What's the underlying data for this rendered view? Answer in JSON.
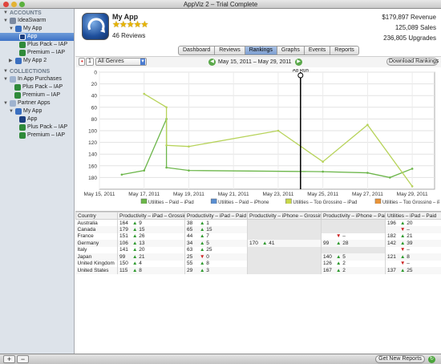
{
  "window": {
    "title": "AppViz 2 – Trial Complete"
  },
  "sidebar": {
    "accounts_header": "ACCOUNTS",
    "account": "IdeaSwarm",
    "my_app": "My App",
    "app": "App",
    "plus_pack": "Plus Pack – IAP",
    "premium": "Premium – IAP",
    "my_app_2": "My App 2",
    "collections_header": "COLLECTIONS",
    "in_app_purchases": "In App Purchases",
    "coll_plus": "Plus Pack – IAP",
    "coll_premium": "Premium – IAP",
    "partner_apps": "Partner Apps",
    "partner_my_app": "My App",
    "partner_app": "App",
    "partner_plus": "Plus Pack – IAP",
    "partner_premium": "Premium – IAP"
  },
  "header": {
    "app_name": "My App",
    "stars": "★★★★★",
    "reviews": "46 Reviews",
    "revenue_value": "$179,897",
    "revenue_label": "Revenue",
    "sales_value": "125,089",
    "sales_label": "Sales",
    "upgrades_value": "236,805",
    "upgrades_label": "Upgrades"
  },
  "tabs": [
    "Dashboard",
    "Reviews",
    "Rankings",
    "Graphs",
    "Events",
    "Reports"
  ],
  "toolbar": {
    "pin_value": "1",
    "genre": "All Genres",
    "date_range": "May 15, 2011 – May 29, 2011",
    "download_button": "Download Rankings"
  },
  "bottom": {
    "get_reports": "Get New Reports",
    "add": "+",
    "remove": "−"
  },
  "chart_data": {
    "type": "line",
    "annotation": "Ad Run",
    "annotation_x": "May 24, 2011",
    "x_ticks": [
      "May 15, 2011",
      "May 17, 2011",
      "May 19, 2011",
      "May 21, 2011",
      "May 23, 2011",
      "May 25, 2011",
      "May 27, 2011",
      "May 29, 2011"
    ],
    "xlim": [
      "May 15, 2011",
      "May 30, 2011"
    ],
    "y_ticks": [
      "0",
      "20",
      "40",
      "60",
      "80",
      "100",
      "120",
      "140",
      "160",
      "180"
    ],
    "ylim": [
      0,
      200
    ],
    "y_inverted": true,
    "grid": true,
    "legend_position": "bottom",
    "series": [
      {
        "name": "Utilities – Paid – iPad",
        "color": "#6cb64a",
        "x": [
          "May 16, 2011",
          "May 17, 2011",
          "May 18, 2011",
          "May 18, 2011",
          "May 18, 2011",
          "May 19, 2011",
          "May 25, 2011",
          "May 27, 2011",
          "May 28, 2011",
          "May 29, 2011"
        ],
        "y": [
          175,
          168,
          80,
          80,
          163,
          168,
          170,
          172,
          180,
          165
        ]
      },
      {
        "name": "Utilities – Top Grossing – iPad",
        "color": "#b7d35a",
        "x": [
          "May 17, 2011",
          "May 18, 2011",
          "May 18, 2011",
          "May 19, 2011",
          "May 23, 2011",
          "May 25, 2011",
          "May 27, 2011",
          "May 29, 2011"
        ],
        "y": [
          37,
          60,
          125,
          127,
          100,
          153,
          90,
          195
        ]
      }
    ],
    "legend_series": [
      {
        "name": "Utilities – Paid – iPad",
        "color": "#6cb64a"
      },
      {
        "name": "Utilities – Paid – iPhone",
        "color": "#5a8ed0"
      },
      {
        "name": "Utilities – Top Grossing – iPad",
        "color": "#c8d84a"
      },
      {
        "name": "Utilities – Top Grossing – iPhone",
        "color": "#e8943a"
      }
    ]
  },
  "table": {
    "headers": [
      "Country",
      "Productivity – iPad – Grossing",
      "Productivity – iPad – Paid",
      "Productivity – iPhone – Grossing",
      "Productivity – iPhone – Paid",
      "Utilities – iPad – Paid"
    ],
    "rows": [
      {
        "country": "Australia",
        "cells": [
          [
            "164",
            "up",
            "9"
          ],
          [
            "38",
            "up",
            "1"
          ],
          null,
          null,
          [
            "196",
            "up",
            "20"
          ]
        ]
      },
      {
        "country": "Canada",
        "cells": [
          [
            "179",
            "up",
            "15"
          ],
          [
            "65",
            "up",
            "15"
          ],
          null,
          null,
          [
            "",
            "dn",
            "–"
          ]
        ]
      },
      {
        "country": "France",
        "cells": [
          [
            "151",
            "up",
            "26"
          ],
          [
            "44",
            "up",
            "7"
          ],
          null,
          [
            "",
            "dn",
            "–"
          ],
          [
            "182",
            "up",
            "21"
          ]
        ]
      },
      {
        "country": "Germany",
        "cells": [
          [
            "106",
            "up",
            "13"
          ],
          [
            "34",
            "up",
            "5"
          ],
          [
            "170",
            "up",
            "41"
          ],
          [
            "99",
            "up",
            "28"
          ],
          [
            "142",
            "up",
            "39"
          ]
        ]
      },
      {
        "country": "Italy",
        "cells": [
          [
            "141",
            "up",
            "20"
          ],
          [
            "63",
            "up",
            "25"
          ],
          null,
          null,
          [
            "",
            "dn",
            "–"
          ]
        ]
      },
      {
        "country": "Japan",
        "cells": [
          [
            "99",
            "up",
            "21"
          ],
          [
            "25",
            "dn",
            "0"
          ],
          null,
          [
            "140",
            "up",
            "5"
          ],
          [
            "121",
            "up",
            "8"
          ]
        ]
      },
      {
        "country": "United Kingdom",
        "cells": [
          [
            "150",
            "up",
            "4"
          ],
          [
            "55",
            "up",
            "8"
          ],
          null,
          [
            "126",
            "up",
            "2"
          ],
          [
            "",
            "dn",
            "–"
          ]
        ]
      },
      {
        "country": "United States",
        "cells": [
          [
            "115",
            "up",
            "8"
          ],
          [
            "29",
            "up",
            "3"
          ],
          null,
          [
            "167",
            "up",
            "2"
          ],
          [
            "137",
            "up",
            "25"
          ]
        ]
      }
    ]
  }
}
